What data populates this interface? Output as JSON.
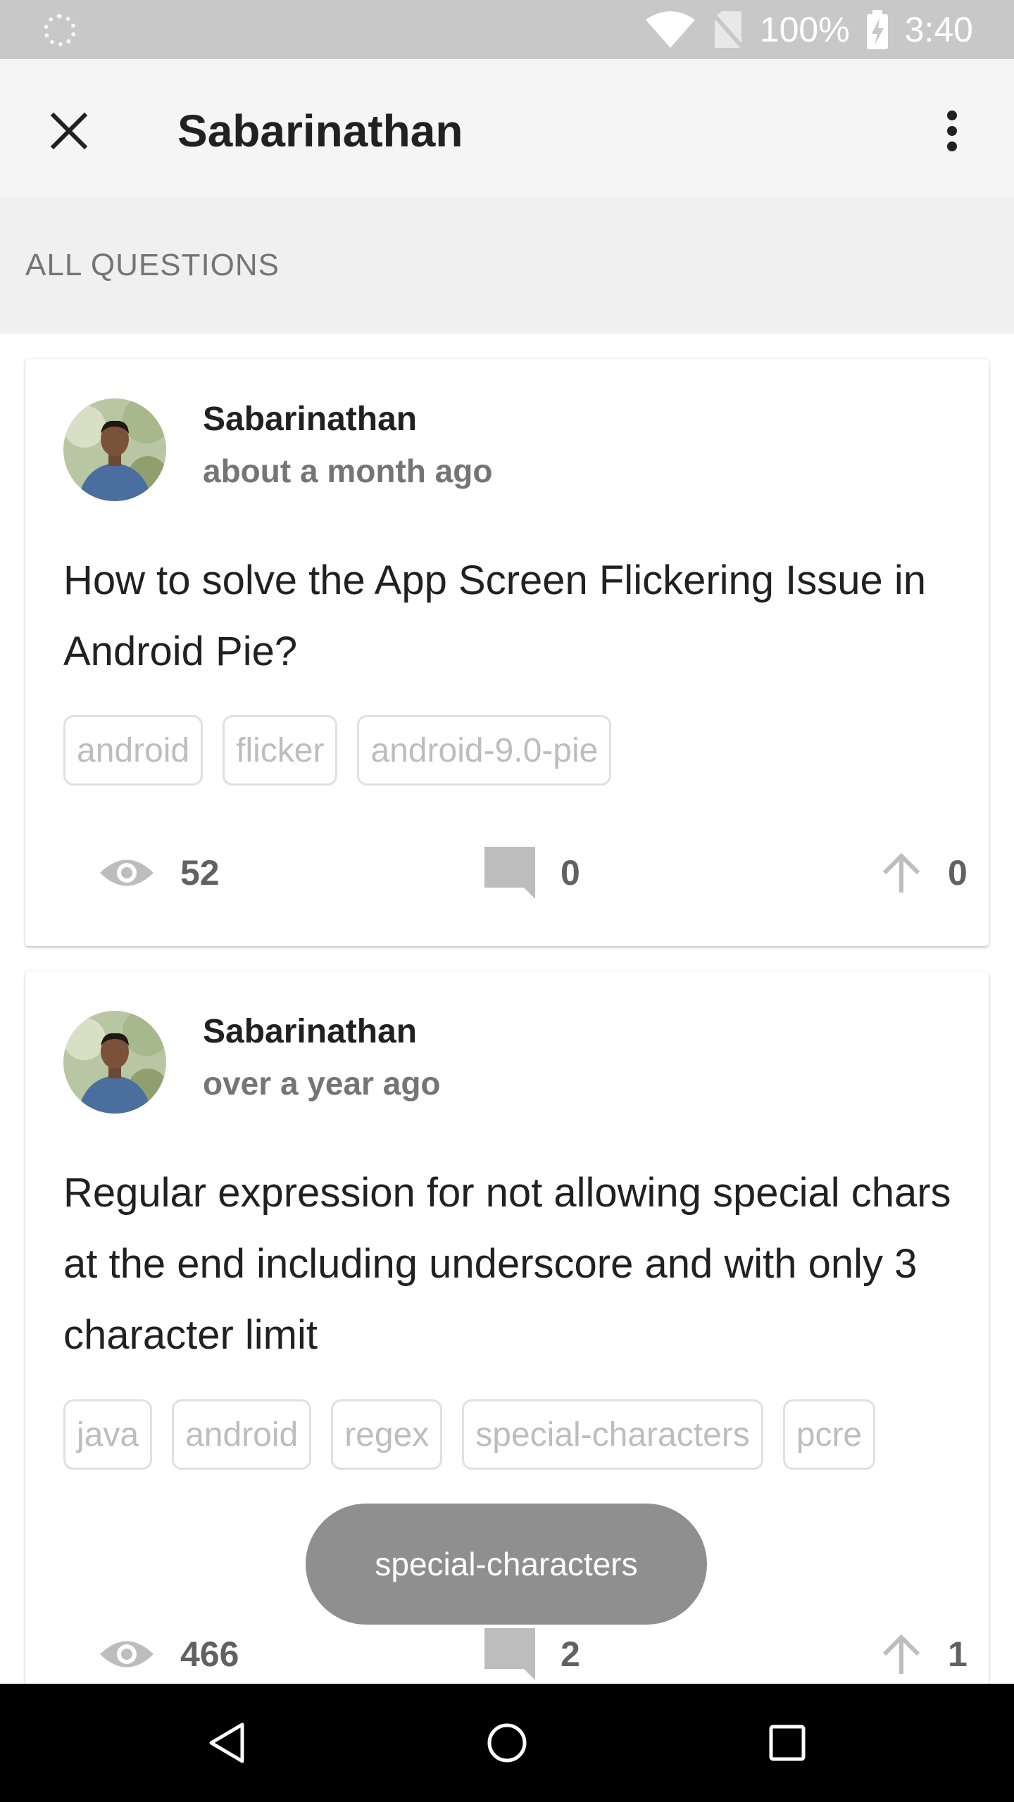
{
  "status_bar": {
    "battery": "100%",
    "time": "3:40",
    "icons": [
      "loading-icon",
      "wifi-icon",
      "no-sim-icon",
      "battery-charging-icon"
    ]
  },
  "app_bar": {
    "title": "Sabarinathan",
    "close_icon": "close-icon",
    "menu_icon": "more-vert-icon"
  },
  "section": {
    "title": "ALL QUESTIONS"
  },
  "questions": [
    {
      "author": "Sabarinathan",
      "time": "about a month ago",
      "title": "How to solve the App Screen Flickering Issue in Android Pie?",
      "tags": [
        "android",
        "flicker",
        "android-9.0-pie"
      ],
      "views": "52",
      "comments": "0",
      "votes": "0"
    },
    {
      "author": "Sabarinathan",
      "time": "over a year ago",
      "title": "Regular expression for not allowing special chars at the end including underscore and with only 3 character limit",
      "tags": [
        "java",
        "android",
        "regex",
        "special-characters",
        "pcre"
      ],
      "views": "466",
      "comments": "2",
      "votes": "1"
    }
  ],
  "toast": {
    "text": "special-characters"
  },
  "nav_bar": {
    "icons": [
      "back-icon",
      "home-icon",
      "recents-icon"
    ]
  },
  "colors": {
    "status_bar": "#c8c8c8",
    "app_bar": "#f5f5f5",
    "section_bg": "#f0f0f0",
    "tag_border": "#e0e0e0",
    "tag_text": "#bdbdbd",
    "toast_bg": "#8f8f8f",
    "icon_gray": "#bdbdbd"
  }
}
